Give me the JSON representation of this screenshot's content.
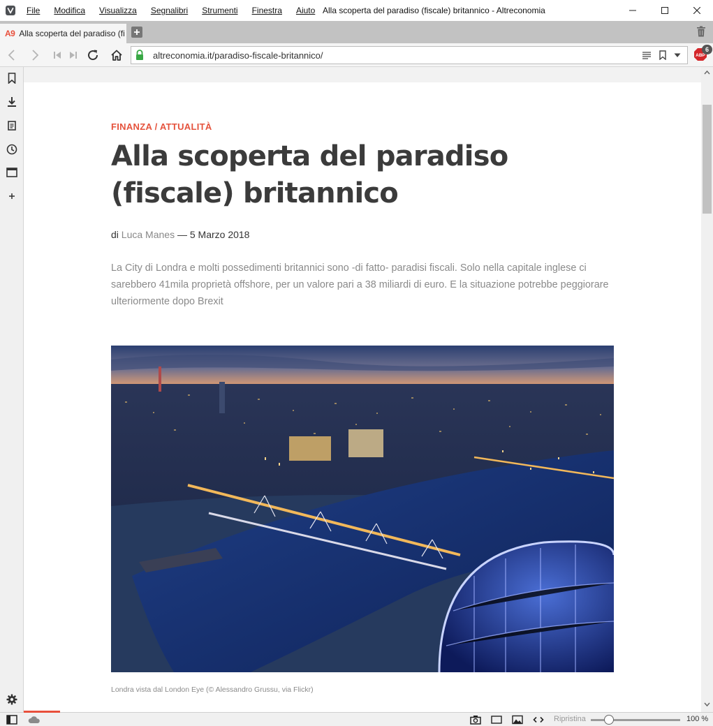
{
  "window": {
    "title": "Alla scoperta del paradiso (fiscale) britannico - Altreconomia"
  },
  "menu": [
    "File",
    "Modifica",
    "Visualizza",
    "Segnalibri",
    "Strumenti",
    "Finestra",
    "Aiuto"
  ],
  "tab": {
    "favicon_text": "A9",
    "title": "Alla scoperta del paradiso (fi"
  },
  "address": {
    "url": "altreconomia.it/paradiso-fiscale-britannico/"
  },
  "extensions": {
    "adblock_label": "ABP",
    "adblock_count": "6"
  },
  "article": {
    "category": "FINANZA / ATTUALITÀ",
    "title": "Alla scoperta del paradiso (fiscale) britannico",
    "byline_prefix": "di",
    "author": "Luca Manes",
    "date_separator": "—",
    "date": "5 Marzo 2018",
    "summary": "La City di Londra e molti possedimenti britannici sono -di fatto- paradisi fiscali. Solo nella capitale inglese ci sarebbero 41mila proprietà offshore, per un valore pari a 38 miliardi di euro. E la situazione potrebbe peggiorare ulteriormente dopo Brexit",
    "image_caption": "Londra vista dal London Eye (© Alessandro Grussu, via Flickr)"
  },
  "statusbar": {
    "restore_label": "Ripristina",
    "zoom": "100 %",
    "zoom_level": 1.0
  },
  "icons": {
    "side": [
      "bookmark-icon",
      "download-icon",
      "notes-icon",
      "history-icon",
      "window-icon",
      "add-panel-icon"
    ],
    "settings": "gear-icon"
  },
  "colors": {
    "accent": "#e5533d",
    "title_text": "#3b3b3b",
    "tab_bar": "#c2c2c2"
  }
}
